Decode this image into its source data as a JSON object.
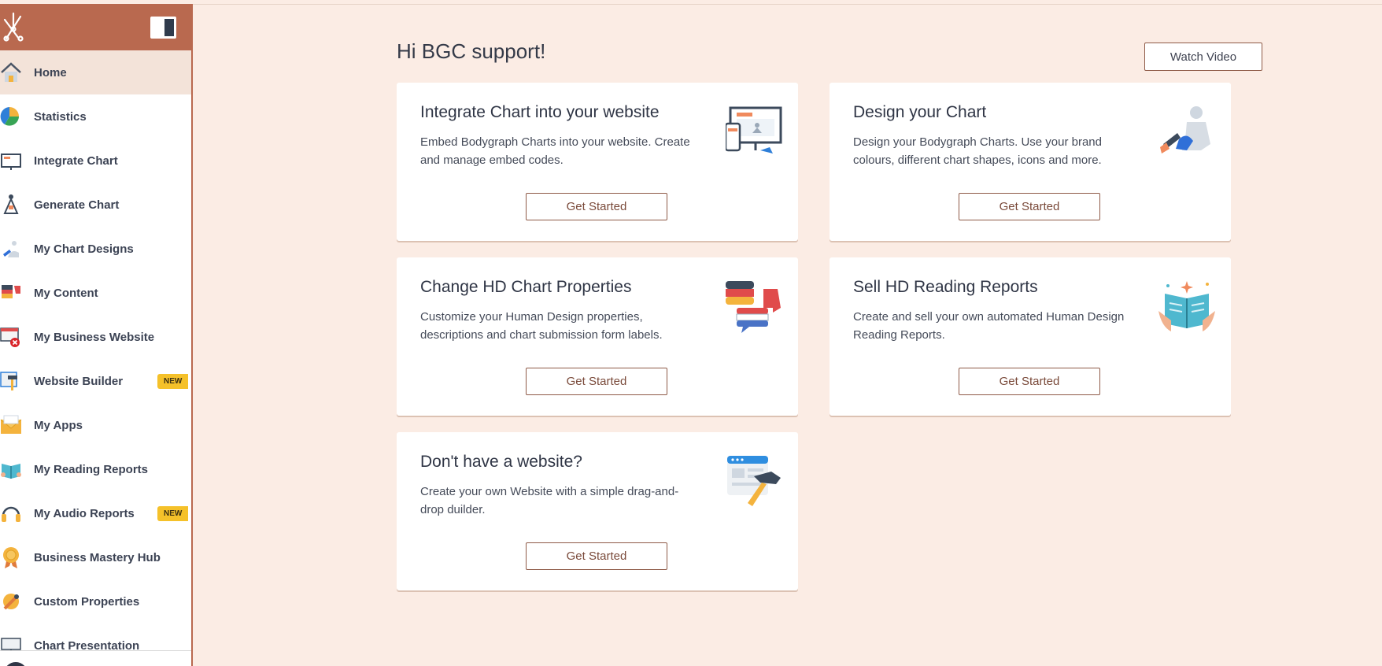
{
  "sidebar": {
    "items": [
      {
        "label": "Home",
        "icon": "home-icon",
        "active": true
      },
      {
        "label": "Statistics",
        "icon": "pie-chart-icon"
      },
      {
        "label": "Integrate Chart",
        "icon": "monitor-icon"
      },
      {
        "label": "Generate Chart",
        "icon": "bodygraph-icon"
      },
      {
        "label": "My Chart Designs",
        "icon": "paint-brush-icon"
      },
      {
        "label": "My Content",
        "icon": "speech-bubbles-icon"
      },
      {
        "label": "My Business Website",
        "icon": "website-error-icon"
      },
      {
        "label": "Website Builder",
        "icon": "hammer-icon",
        "badge": "NEW"
      },
      {
        "label": "My Apps",
        "icon": "envelope-icon"
      },
      {
        "label": "My Reading Reports",
        "icon": "book-icon"
      },
      {
        "label": "My Audio Reports",
        "icon": "headphones-icon",
        "badge": "NEW"
      },
      {
        "label": "Business Mastery Hub",
        "icon": "medal-icon"
      },
      {
        "label": "Custom Properties",
        "icon": "wrench-icon"
      },
      {
        "label": "Chart Presentation",
        "icon": "presentation-icon"
      }
    ]
  },
  "main": {
    "greeting": "Hi BGC support!",
    "watch_video_label": "Watch Video",
    "cards": [
      {
        "title": "Integrate Chart into your website",
        "description": "Embed Bodygraph Charts into your website. Create and manage embed codes.",
        "button": "Get Started",
        "icon": "devices-illustration-icon"
      },
      {
        "title": "Design your Chart",
        "description": "Design your Bodygraph Charts. Use your brand colours, different chart shapes, icons and more.",
        "button": "Get Started",
        "icon": "paint-figure-illustration-icon"
      },
      {
        "title": "Change HD Chart Properties",
        "description": "Customize your Human Design properties, descriptions and chart submission form labels.",
        "button": "Get Started",
        "icon": "flag-bubbles-illustration-icon"
      },
      {
        "title": "Sell HD Reading Reports",
        "description": "Create and sell your own automated Human Design Reading Reports.",
        "button": "Get Started",
        "icon": "open-book-illustration-icon"
      },
      {
        "title": "Don't have a website?",
        "description": "Create your own Website with a simple drag-and-drop duilder.",
        "button": "Get Started",
        "icon": "website-hammer-illustration-icon"
      }
    ]
  },
  "colors": {
    "brand": "#b9694f",
    "background": "#fbece4",
    "badge": "#f5c12a",
    "active_item": "#f3e3d9"
  }
}
